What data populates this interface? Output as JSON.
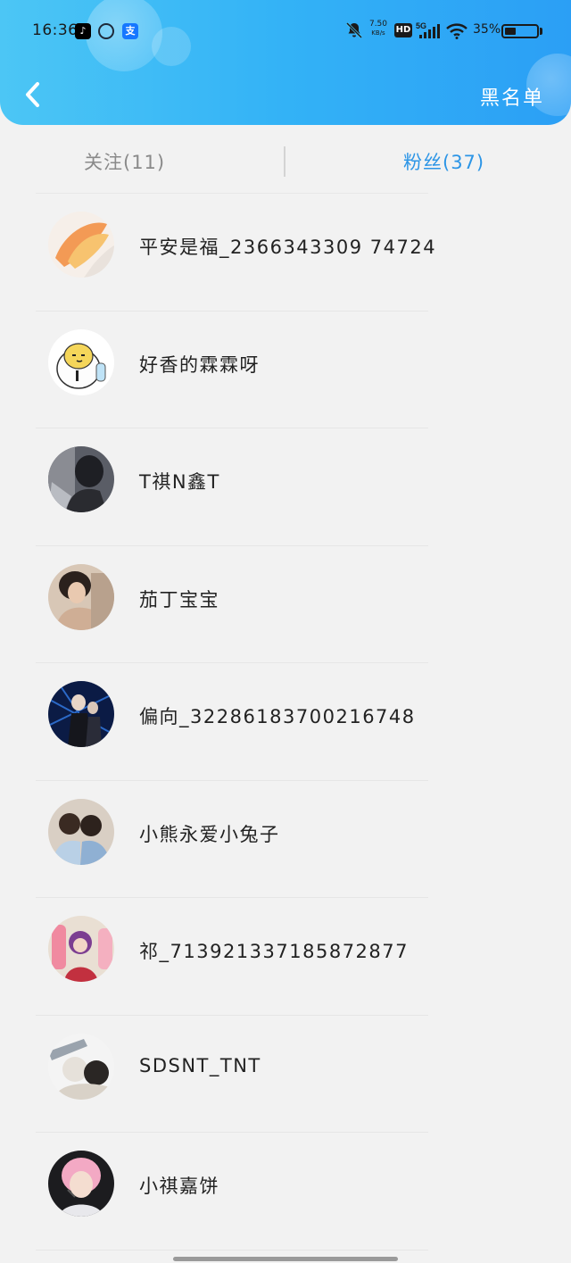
{
  "status_bar": {
    "time": "16:36",
    "net_speed_value": "7.50",
    "net_speed_unit": "KB/s",
    "hd_label": "HD",
    "network": "5G",
    "battery_percent": "35%",
    "battery_level": 0.35,
    "app_icons": [
      "tiktok-icon",
      "loop-app-icon",
      "alipay-icon"
    ],
    "alipay_glyph": "支"
  },
  "header": {
    "back_icon": "chevron-left-icon",
    "blacklist_label": "黑名单"
  },
  "tabs": {
    "following_label": "关注(11)",
    "fans_label": "粉丝(37)",
    "active": "fans",
    "active_color": "#2c95e6"
  },
  "fans": [
    {
      "name": "平安是福_2366343309 74724"
    },
    {
      "name": "好香的霖霖呀"
    },
    {
      "name": "T祺N鑫T"
    },
    {
      "name": "茄丁宝宝"
    },
    {
      "name": "偏向_32286183700216748"
    },
    {
      "name": "小熊永爱小兔子"
    },
    {
      "name": "祁_713921337185872877"
    },
    {
      "name": "SDSNT_TNT"
    },
    {
      "name": "小祺嘉饼"
    }
  ],
  "colors": {
    "header_gradient_start": "#4cc6f5",
    "header_gradient_end": "#2b9ff5",
    "background": "#f2f2f2"
  }
}
